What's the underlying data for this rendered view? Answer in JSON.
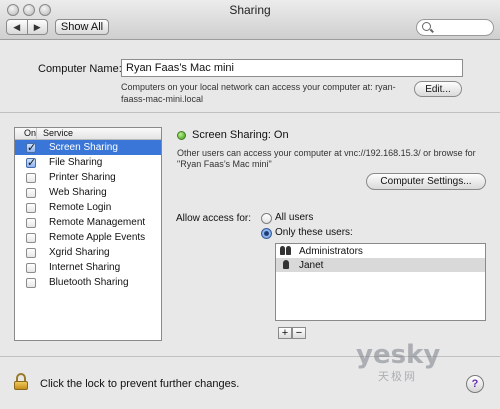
{
  "window": {
    "title": "Sharing"
  },
  "toolbar": {
    "show_all_label": "Show All",
    "back_icon": "◀",
    "forward_icon": "▶"
  },
  "computer_name": {
    "label": "Computer Name:",
    "value": "Ryan Faas’s Mac mini",
    "description": "Computers on your local network can access your computer at: ryan-faass-mac-mini.local",
    "edit_label": "Edit..."
  },
  "services": {
    "header_on": "On",
    "header_service": "Service",
    "items": [
      {
        "label": "Screen Sharing",
        "on": true,
        "selected": true
      },
      {
        "label": "File Sharing",
        "on": true,
        "selected": false
      },
      {
        "label": "Printer Sharing",
        "on": false,
        "selected": false
      },
      {
        "label": "Web Sharing",
        "on": false,
        "selected": false
      },
      {
        "label": "Remote Login",
        "on": false,
        "selected": false
      },
      {
        "label": "Remote Management",
        "on": false,
        "selected": false
      },
      {
        "label": "Remote Apple Events",
        "on": false,
        "selected": false
      },
      {
        "label": "Xgrid Sharing",
        "on": false,
        "selected": false
      },
      {
        "label": "Internet Sharing",
        "on": false,
        "selected": false
      },
      {
        "label": "Bluetooth Sharing",
        "on": false,
        "selected": false
      }
    ]
  },
  "detail": {
    "status": "Screen Sharing: On",
    "info": "Other users can access your computer at vnc://192.168.15.3/ or browse for \"Ryan Faas’s Mac mini\"",
    "settings_button": "Computer Settings...",
    "allow_access_label": "Allow access for:",
    "option_all": "All users",
    "option_only": "Only these users:",
    "selected_option": "only",
    "users": [
      {
        "name": "Administrators",
        "icon": "group-icon",
        "selected": false
      },
      {
        "name": "Janet",
        "icon": "user-icon",
        "selected": true
      }
    ],
    "add_label": "+",
    "remove_label": "−"
  },
  "footer": {
    "lock_text": "Click the lock to prevent further changes.",
    "help_label": "?"
  },
  "watermark": {
    "main": "yesky",
    "sub": "天极网"
  },
  "colors": {
    "selection": "#3a76d7",
    "status_on": "#3a9a14"
  }
}
